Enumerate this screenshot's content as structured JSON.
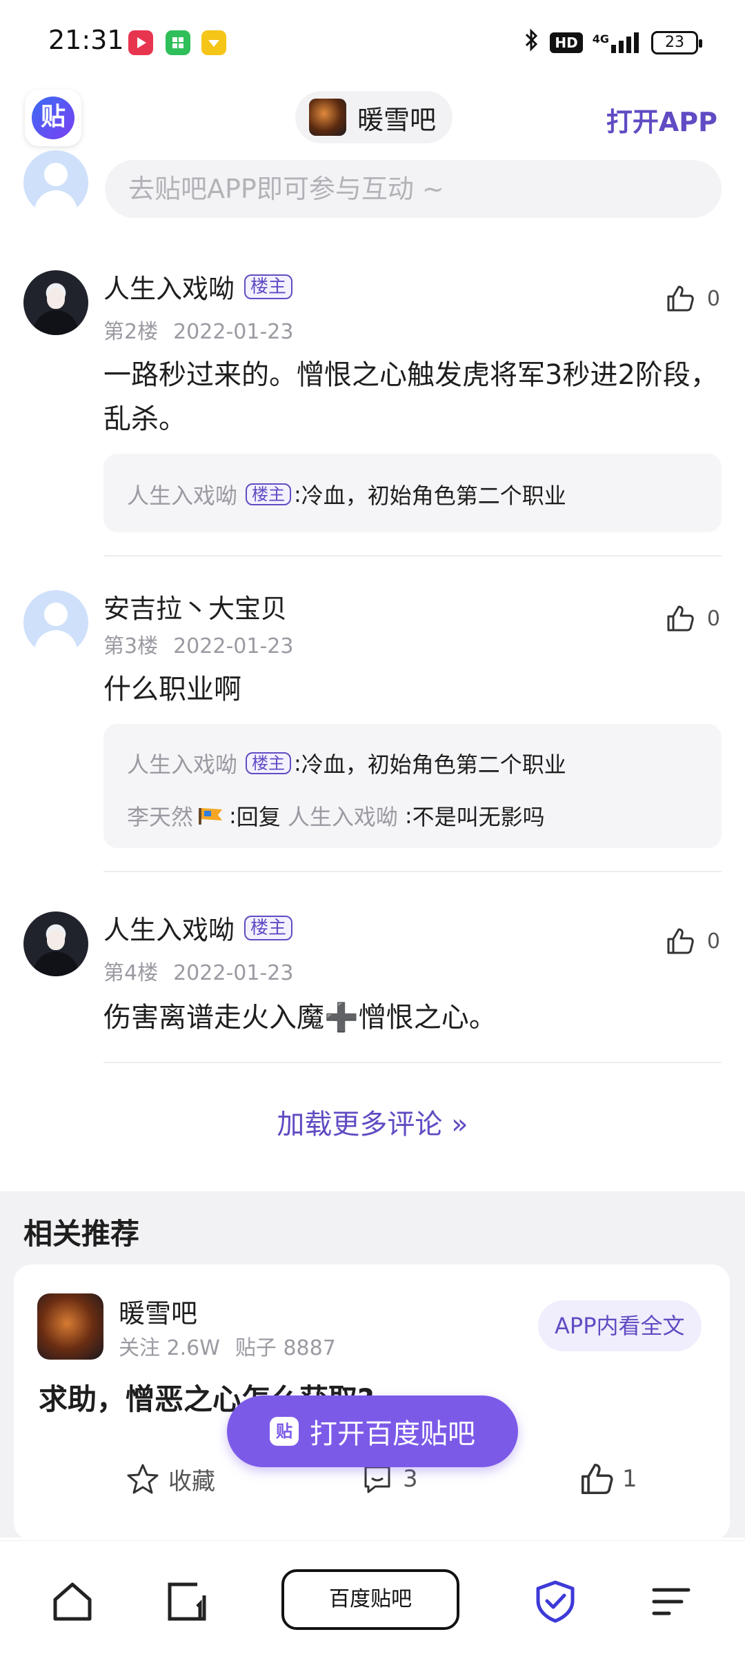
{
  "status_bar": {
    "time": "21:31",
    "network": "4G",
    "battery": "23"
  },
  "header": {
    "logo_text": "贴",
    "forum_name": "暖雪吧",
    "open_app": "打开APP"
  },
  "reply_input": {
    "placeholder": "去贴吧APP即可参与互动 ~"
  },
  "posts": [
    {
      "username": "人生入戏呦",
      "badge": "楼主",
      "floor": "第2楼",
      "date": "2022-01-23",
      "likes": "0",
      "content": "一路秒过来的。憎恨之心触发虎将军3秒进2阶段，乱杀。",
      "replies": [
        {
          "name": "人生入戏呦",
          "badge": "楼主",
          "sep": ":",
          "text": "冷血，初始角色第二个职业"
        }
      ]
    },
    {
      "username": "安吉拉丶大宝贝",
      "floor": "第3楼",
      "date": "2022-01-23",
      "likes": "0",
      "content": "什么职业啊",
      "replies": [
        {
          "name": "人生入戏呦",
          "badge": "楼主",
          "sep": ":",
          "text": "冷血，初始角色第二个职业"
        },
        {
          "name": "李天然",
          "sep": ":",
          "reply_word": "回复",
          "reply_to": "人生入戏呦",
          "sep2": ":",
          "text": "不是叫无影吗"
        }
      ]
    },
    {
      "username": "人生入戏呦",
      "badge": "楼主",
      "floor": "第4楼",
      "date": "2022-01-23",
      "likes": "0",
      "content": "伤害离谱走火入魔➕憎恨之心。"
    }
  ],
  "load_more": "加载更多评论 »",
  "related": {
    "title": "相关推荐",
    "card": {
      "forum_name": "暖雪吧",
      "follow": "关注 2.6W",
      "posts": "贴子 8887",
      "app_button": "APP内看全文",
      "post_title": "求助，憎恶之心怎么获取?",
      "collect_label": "收藏",
      "comments": "3",
      "likes": "1"
    }
  },
  "float_button": {
    "logo_text": "贴",
    "label": "打开百度贴吧"
  },
  "bottom_nav": {
    "center_label": "百度贴吧"
  },
  "colors": {
    "accent": "#614bc3",
    "button": "#7c5ae8",
    "secondary_text": "#9a9aa2"
  }
}
